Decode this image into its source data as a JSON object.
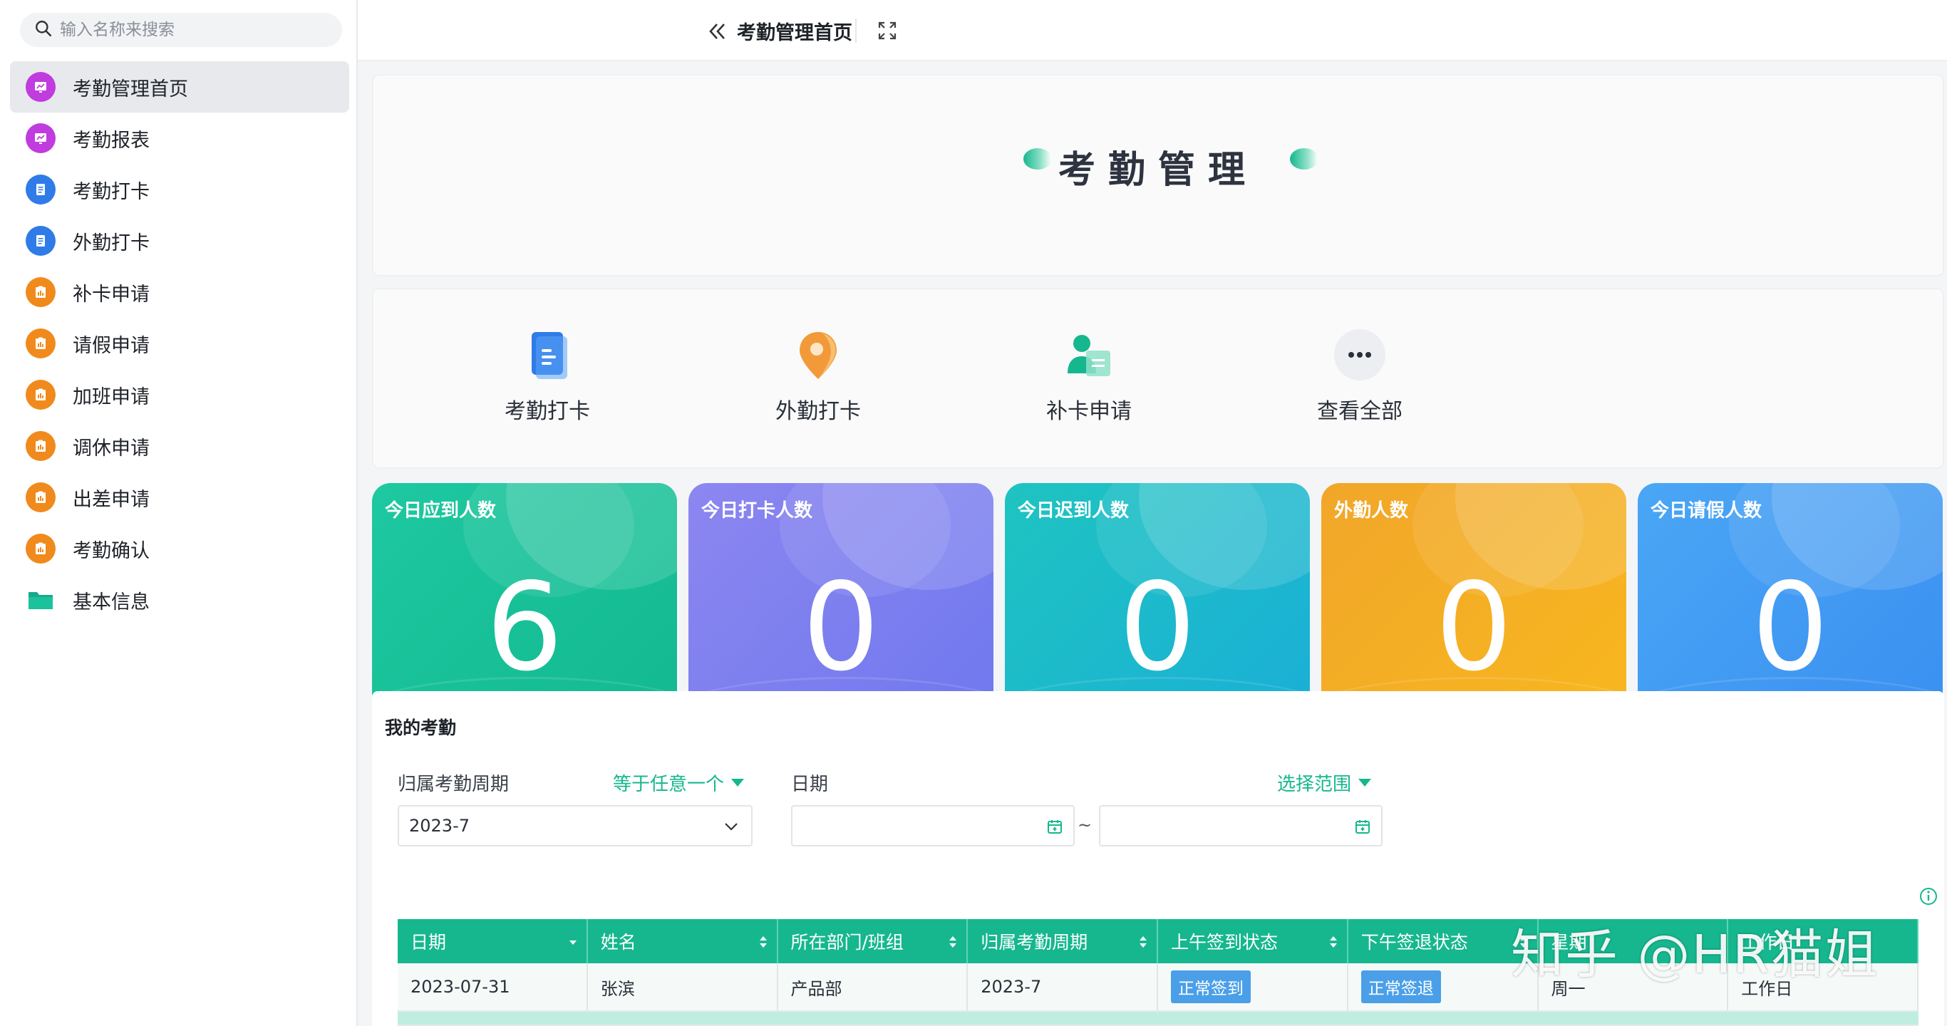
{
  "search": {
    "placeholder": "输入名称来搜索"
  },
  "sidebar": {
    "items": [
      {
        "label": "考勤管理首页",
        "icon": "chart-icon",
        "color": "#c03cde"
      },
      {
        "label": "考勤报表",
        "icon": "chart-icon",
        "color": "#c03cde"
      },
      {
        "label": "考勤打卡",
        "icon": "document-icon",
        "color": "#2f7be8"
      },
      {
        "label": "外勤打卡",
        "icon": "document-icon",
        "color": "#2f7be8"
      },
      {
        "label": "补卡申请",
        "icon": "form-icon",
        "color": "#f08a1c"
      },
      {
        "label": "请假申请",
        "icon": "form-icon",
        "color": "#f08a1c"
      },
      {
        "label": "加班申请",
        "icon": "form-icon",
        "color": "#f08a1c"
      },
      {
        "label": "调休申请",
        "icon": "form-icon",
        "color": "#f08a1c"
      },
      {
        "label": "出差申请",
        "icon": "form-icon",
        "color": "#f08a1c"
      },
      {
        "label": "考勤确认",
        "icon": "form-icon",
        "color": "#f08a1c"
      },
      {
        "label": "基本信息",
        "icon": "folder-icon",
        "color": "#16a98a"
      }
    ]
  },
  "topbar": {
    "title": "考勤管理首页"
  },
  "banner": {
    "title": "考勤管理"
  },
  "quick": {
    "items": [
      {
        "label": "考勤打卡",
        "icon": "clipboard-icon"
      },
      {
        "label": "外勤打卡",
        "icon": "location-pin-icon"
      },
      {
        "label": "补卡申请",
        "icon": "user-card-icon"
      },
      {
        "label": "查看全部",
        "icon": "more-icon"
      }
    ]
  },
  "stats": [
    {
      "title": "今日应到人数",
      "value": "6",
      "color_from": "#1ec8a0",
      "color_to": "#12b890"
    },
    {
      "title": "今日打卡人数",
      "value": "0",
      "color_from": "#8c86f0",
      "color_to": "#6e78ee"
    },
    {
      "title": "今日迟到人数",
      "value": "0",
      "color_from": "#1ec4c0",
      "color_to": "#1aaed8"
    },
    {
      "title": "外勤人数",
      "value": "0",
      "color_from": "#f1a62a",
      "color_to": "#f8b81e"
    },
    {
      "title": "今日请假人数",
      "value": "0",
      "color_from": "#4aa6f5",
      "color_to": "#3a8ff0"
    }
  ],
  "attendance": {
    "title": "我的考勤",
    "filter_period_label": "归属考勤周期",
    "filter_period_op": "等于任意一个",
    "filter_period_value": "2023-7",
    "filter_date_label": "日期",
    "filter_date_op": "选择范围",
    "date_sep": "~",
    "columns": [
      "日期",
      "姓名",
      "所在部门/班组",
      "归属考勤周期",
      "上午签到状态",
      "下午签退状态",
      "星期",
      "工作日"
    ],
    "rows": [
      [
        "2023-07-31",
        "张滨",
        "产品部",
        "2023-7",
        "正常签到",
        "正常签退",
        "周一",
        "工作日"
      ]
    ]
  },
  "watermark": "知乎 @HR猫姐"
}
